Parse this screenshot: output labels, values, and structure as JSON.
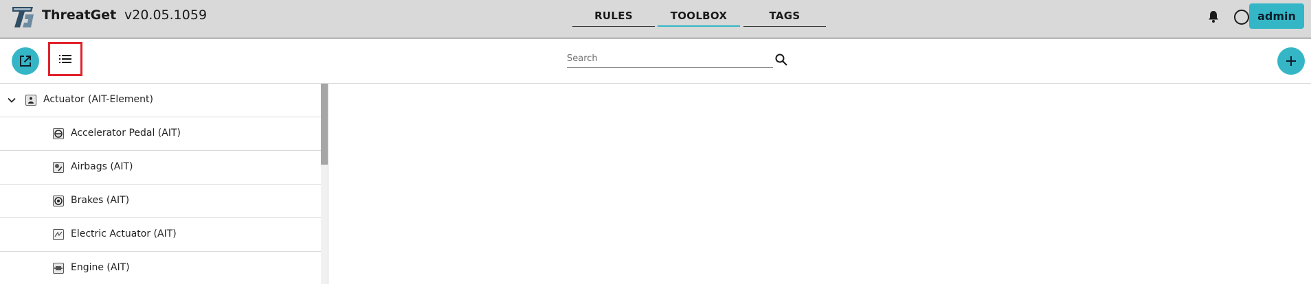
{
  "header": {
    "app_name": "ThreatGet",
    "version": "v20.05.1059",
    "tabs": [
      {
        "label": "RULES"
      },
      {
        "label": "TOOLBOX"
      },
      {
        "label": "TAGS"
      }
    ],
    "active_tab": "TOOLBOX",
    "user_button": "admin"
  },
  "toolbar": {
    "search_placeholder": "Search"
  },
  "tree": {
    "parent": {
      "name": "Actuator",
      "type": "(AIT-Element)",
      "expanded": true,
      "icon": "actuator-icon"
    },
    "children": [
      {
        "label": "Accelerator Pedal (AIT)",
        "icon": "accelerator-pedal-icon"
      },
      {
        "label": "Airbags (AIT)",
        "icon": "airbags-icon"
      },
      {
        "label": "Brakes (AIT)",
        "icon": "brakes-icon"
      },
      {
        "label": "Electric Actuator (AIT)",
        "icon": "electric-actuator-icon"
      },
      {
        "label": "Engine (AIT)",
        "icon": "engine-icon"
      }
    ]
  },
  "colors": {
    "accent": "#35b6c7",
    "header_bg": "#d9d9d9",
    "highlight_border": "#e0202a"
  }
}
